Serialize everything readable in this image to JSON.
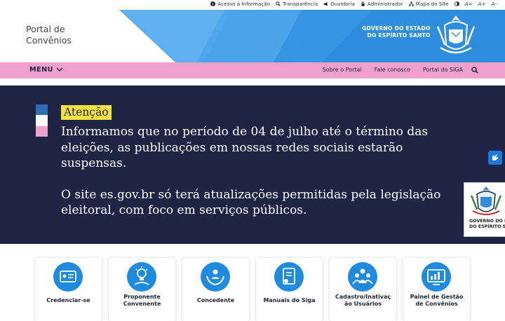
{
  "toplinks": {
    "acesso": "Acesso à Informação",
    "transparencia": "Transparência",
    "ouvidoria": "Ouvidoria",
    "administrador": "Administrador",
    "mapa": "Mapa do Site",
    "font_up_1": "A=",
    "font_up_2": "A+",
    "font_down": "A-"
  },
  "header": {
    "site_line1": "Portal de",
    "site_line2": "Convênios",
    "gov_line1": "GOVERNO DO ESTADO",
    "gov_line2": "DO ESPÍRITO SANTO"
  },
  "nav": {
    "menu": "MENU",
    "sobre": "Sobre o Portal",
    "fale": "Fale conosco",
    "siga": "Portal do SIGA"
  },
  "banner": {
    "badge": "Atenção",
    "p1": "Informamos que no período de 04 de julho até o término das eleições, as publicações em nossas redes sociais estarão suspensas.",
    "p2": "O site es.gov.br só terá atualizações permitidas pela legislação eleitoral, com foco em serviços públicos."
  },
  "sidelogo": {
    "line1": "GOVERNO DO ES",
    "line2": "DO ESPÍRITO SA"
  },
  "cards": [
    {
      "line1": "Credenciar-se",
      "line2": ""
    },
    {
      "line1": "Proponente",
      "line2": "Convenente"
    },
    {
      "line1": "Concedente",
      "line2": ""
    },
    {
      "line1": "Manuais do Siga",
      "line2": ""
    },
    {
      "line1": "Cadastro/Inativaç",
      "line2": "ão Usuários"
    },
    {
      "line1": "Painel de Gestão",
      "line2": "de Convênios"
    }
  ],
  "colors": {
    "navy": "#1f2444",
    "pink": "#f0a0cc",
    "blue": "#1e8ae0",
    "yellow": "#f6e23e"
  }
}
